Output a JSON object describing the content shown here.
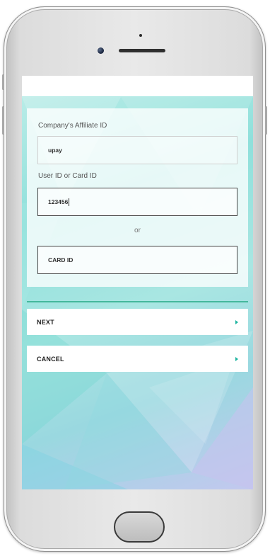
{
  "form": {
    "affiliate_label": "Company's Affiliate ID",
    "affiliate_value": "upay",
    "user_label": "User ID or Card ID",
    "user_value": "123456",
    "separator": "or",
    "card_placeholder": "CARD ID"
  },
  "actions": {
    "next_label": "NEXT",
    "cancel_label": "CANCEL"
  },
  "colors": {
    "accent": "#45b89c",
    "arrow": "#1fb5a0"
  }
}
